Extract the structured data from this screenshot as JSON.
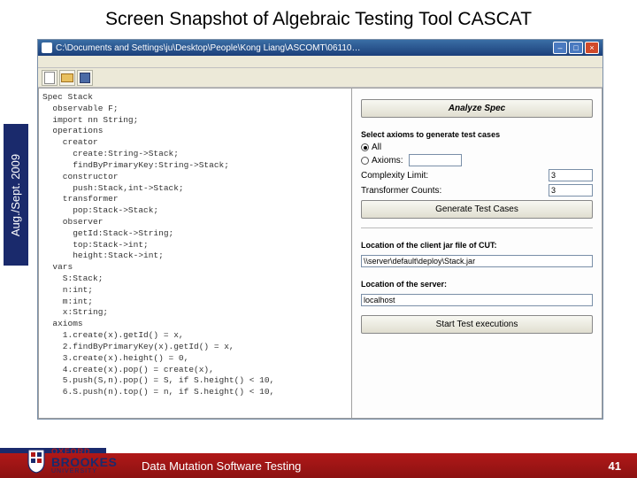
{
  "slide": {
    "title": "Screen Snapshot of Algebraic Testing Tool CASCAT",
    "side_label": "Aug./Sept. 2009",
    "footer_text": "Data Mutation Software Testing",
    "page_number": "41",
    "logo": {
      "top": "OXFORD",
      "main": "BROOKES",
      "bottom": "UNIVERSITY"
    }
  },
  "window": {
    "title": "C:\\Documents and Settings\\ju\\Desktop\\People\\Kong Liang\\ASCOMT\\06110…",
    "toolbar": {
      "new": "new-file",
      "open": "open-file",
      "save": "save-file"
    }
  },
  "spec": {
    "header": "Spec Stack",
    "lines": [
      "  observable F;",
      "  import nn String;",
      "  operations",
      "    creator",
      "      create:String->Stack;",
      "      findByPrimaryKey:String->Stack;",
      "    constructor",
      "      push:Stack,int->Stack;",
      "    transformer",
      "      pop:Stack->Stack;",
      "    observer",
      "      getId:Stack->String;",
      "      top:Stack->int;",
      "      height:Stack->int;",
      "  vars",
      "    S:Stack;",
      "    n:int;",
      "    m:int;",
      "    x:String;",
      "  axioms",
      "    1.create(x).getId() = x,",
      "    2.findByPrimaryKey(x).getId() = x,",
      "    3.create(x).height() = 0,",
      "    4.create(x).pop() = create(x),",
      "    5.push(S,n).pop() = S, if S.height() < 10,",
      "    6.S.push(n).top() = n, if S.height() < 10,"
    ]
  },
  "controls": {
    "analyze_btn": "Analyze Spec",
    "axioms_header": "Select axioms to generate test cases",
    "radio_all": "All",
    "radio_axioms": "Axioms:",
    "axiom_value": "",
    "complexity_label": "Complexity Limit:",
    "complexity_value": "3",
    "transformer_label": "Transformer Counts:",
    "transformer_value": "3",
    "gen_btn": "Generate Test Cases",
    "loc_jar_label": "Location of the client jar file of CUT:",
    "loc_jar_value": "\\\\server\\default\\deploy\\Stack.jar",
    "loc_srv_label": "Location of the server:",
    "loc_srv_value": "localhost",
    "start_btn": "Start Test executions"
  }
}
